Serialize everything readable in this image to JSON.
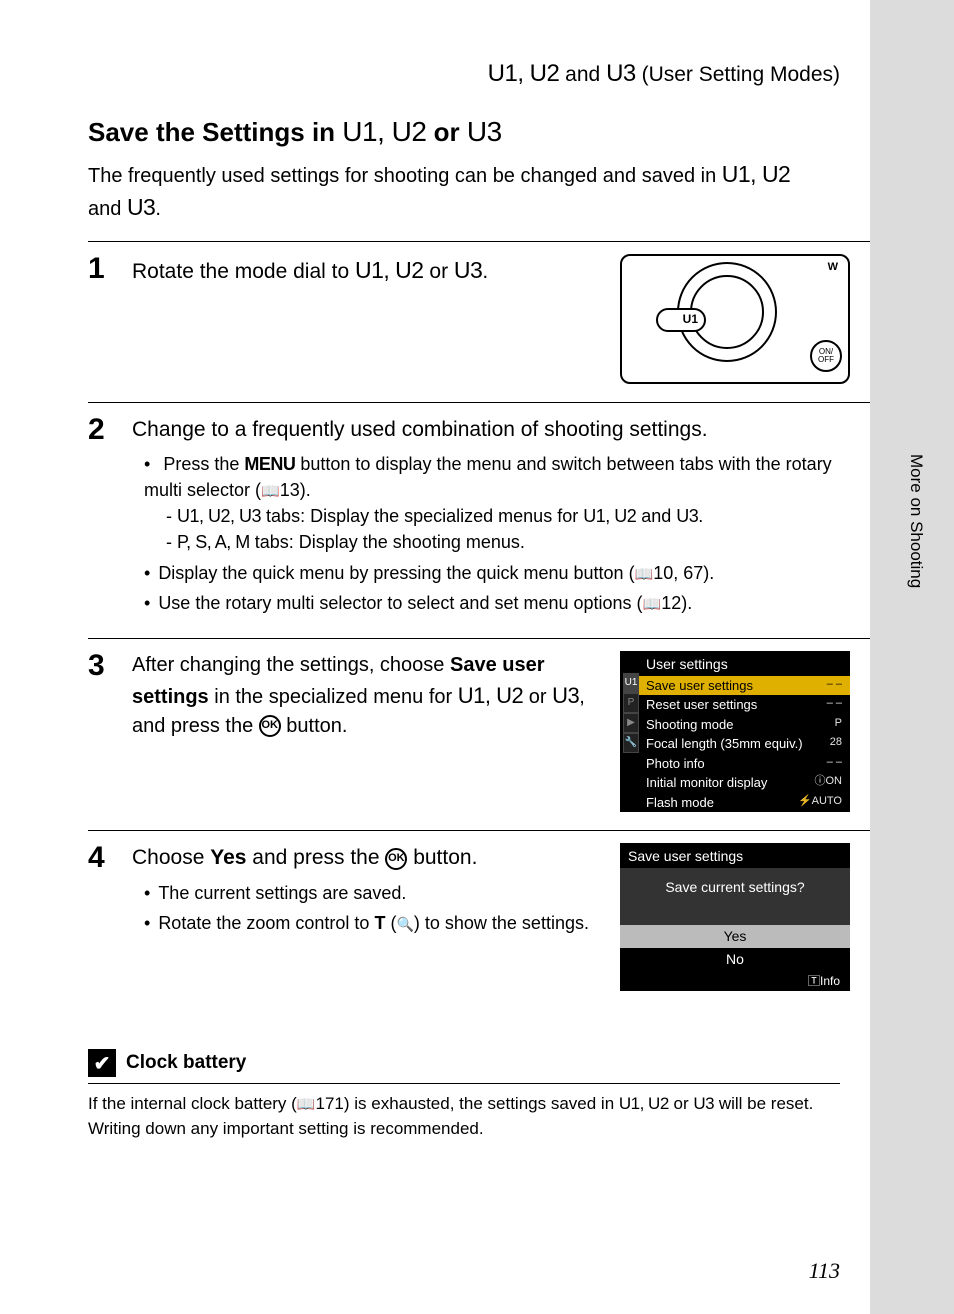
{
  "header": {
    "breadcrumb_modes": "U1, U2",
    "breadcrumb_and": " and ",
    "breadcrumb_mode3": "U3",
    "breadcrumb_suffix": " (User Setting Modes)"
  },
  "title": {
    "prefix": "Save the Settings in ",
    "modes12": "U1, U2",
    "or": " or ",
    "mode3": "U3"
  },
  "intro": {
    "line1_a": "The frequently used settings for shooting can be changed and saved in ",
    "line1_modes": "U1, U2",
    "line2_a": "and ",
    "line2_mode": "U3",
    "line2_b": "."
  },
  "steps": {
    "s1": {
      "num": "1",
      "text_a": "Rotate the mode dial to ",
      "text_modes": "U1, U2",
      "text_or": " or ",
      "text_mode3": "U3",
      "text_end": ".",
      "dial_label": "U1",
      "dial_onoff": "ON/\nOFF",
      "dial_w": "W"
    },
    "s2": {
      "num": "2",
      "lead": "Change to a frequently used combination of shooting settings.",
      "b1_a": "Press the ",
      "b1_menu": "MENU",
      "b1_b": " button to display the menu and switch between tabs with the rotary multi selector (",
      "b1_ref": "13).",
      "b1_s1_a": "- ",
      "b1_s1_modes": "U1, U2, U3",
      "b1_s1_b": " tabs: Display the specialized menus for ",
      "b1_s1_modes2": "U1, U2",
      "b1_s1_and": " and ",
      "b1_s1_mode3": "U3",
      "b1_s1_end": ".",
      "b1_s2_a": "- ",
      "b1_s2_modes": "P, S, A, M",
      "b1_s2_b": " tabs: Display the shooting menus.",
      "b2_a": "Display the quick menu by pressing the quick menu button (",
      "b2_ref": "10, 67).",
      "b3_a": "Use the rotary multi selector to select and set menu options (",
      "b3_ref": "12)."
    },
    "s3": {
      "num": "3",
      "text_a": "After changing the settings, choose ",
      "text_bold": "Save user settings",
      "text_b": " in the specialized menu for ",
      "text_modes": "U1, U2",
      "text_or": " or ",
      "text_mode3": "U3",
      "text_c": ", and press the ",
      "text_ok": "OK",
      "text_d": " button.",
      "lcd": {
        "title": "User settings",
        "tab": "U1",
        "rows": [
          {
            "l": "Save user settings",
            "v": "– –",
            "sel": true
          },
          {
            "l": "Reset user settings",
            "v": "– –"
          },
          {
            "l": "Shooting mode",
            "v": "P"
          },
          {
            "l": "Focal length (35mm equiv.)",
            "v": "28"
          },
          {
            "l": "Photo info",
            "v": "– –"
          },
          {
            "l": "Initial monitor display",
            "v": "ⓘON"
          },
          {
            "l": "Flash mode",
            "v": "⚡AUTO"
          }
        ]
      }
    },
    "s4": {
      "num": "4",
      "lead_a": "Choose ",
      "lead_bold": "Yes",
      "lead_b": " and press the ",
      "lead_ok": "OK",
      "lead_c": " button.",
      "b1": "The current settings are saved.",
      "b2_a": "Rotate the zoom control to ",
      "b2_T": "T",
      "b2_b": " (",
      "b2_c": ") to show the settings.",
      "lcd": {
        "title": "Save user settings",
        "prompt": "Save current settings?",
        "yes": "Yes",
        "no": "No",
        "info": "Info"
      }
    }
  },
  "note": {
    "check": "✔",
    "title": "Clock battery",
    "body_a": "If the internal clock battery (",
    "body_ref": "171) is exhausted, the settings saved in ",
    "body_modes": "U1, U2",
    "body_or": " or ",
    "body_mode3": "U3",
    "body_b": " will be reset. Writing down any important setting is recommended."
  },
  "side_label": "More on Shooting",
  "page_number": "113"
}
